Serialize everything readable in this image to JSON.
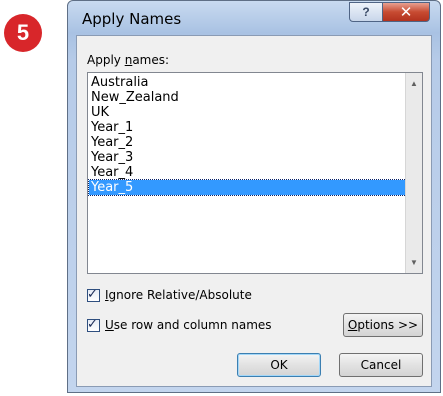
{
  "step": {
    "number": "5"
  },
  "dialog": {
    "title": "Apply Names",
    "help_label": "?",
    "close_label": "✕",
    "apply_names_label_pre": "Apply ",
    "apply_names_label_hot": "n",
    "apply_names_label_post": "ames:",
    "names": [
      "Australia",
      "New_Zealand",
      "UK",
      "Year_1",
      "Year_2",
      "Year_3",
      "Year_4",
      "Year_5"
    ],
    "selected_name": "Year_5",
    "ignore_relative": {
      "hot": "I",
      "rest": "gnore Relative/Absolute",
      "checked": true
    },
    "use_row_column": {
      "hot": "U",
      "rest": "se row and column names",
      "checked": true
    },
    "options_button": {
      "hot": "O",
      "rest": "ptions >>"
    },
    "ok_label": "OK",
    "cancel_label": "Cancel"
  },
  "colors": {
    "selection": "#3399ff",
    "badge": "#d8262a",
    "close": "#c74b32"
  }
}
